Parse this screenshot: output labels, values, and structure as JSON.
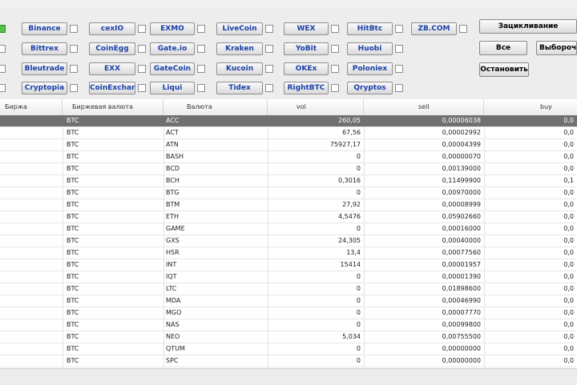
{
  "exchanges": [
    {
      "label": "Binance",
      "checked": false
    },
    {
      "label": "cexIO",
      "checked": false
    },
    {
      "label": "EXMO",
      "checked": false
    },
    {
      "label": "LiveCoin",
      "checked": false
    },
    {
      "label": "WEX",
      "checked": false
    },
    {
      "label": "HitBtc",
      "checked": false
    },
    {
      "label": "ZB.COM",
      "checked": false
    },
    {
      "label": "Bittrex",
      "checked": false
    },
    {
      "label": "CoinEgg",
      "checked": false
    },
    {
      "label": "Gate.io",
      "checked": false
    },
    {
      "label": "Kraken",
      "checked": false
    },
    {
      "label": "YoBit",
      "checked": false
    },
    {
      "label": "Huobi",
      "checked": false
    },
    {
      "label": "Bleutrade",
      "checked": false
    },
    {
      "label": "EXX",
      "checked": false
    },
    {
      "label": "GateCoin",
      "checked": false
    },
    {
      "label": "Kucoin",
      "checked": false
    },
    {
      "label": "OKEx",
      "checked": false
    },
    {
      "label": "Poloniex",
      "checked": false
    },
    {
      "label": "Cryptopia",
      "checked": false
    },
    {
      "label": "CoinExchange",
      "checked": false
    },
    {
      "label": "Liqui",
      "checked": false
    },
    {
      "label": "Tidex",
      "checked": false
    },
    {
      "label": "RightBTC",
      "checked": false
    },
    {
      "label": "Qryptos",
      "checked": false
    }
  ],
  "left_checkboxes_checked": [
    true,
    false,
    false,
    false
  ],
  "actions": {
    "loop": "Зацикливание",
    "all": "Все",
    "selective": "Выборочн",
    "stop": "Остановить"
  },
  "table": {
    "headers": [
      "Биржа",
      "Биржевая валюта",
      "Валюта",
      "vol",
      "sell",
      "buy"
    ],
    "rows": [
      {
        "exchange": "",
        "base": "BTC",
        "currency": "ACC",
        "vol": "260,05",
        "sell": "0,00006038",
        "buy": "0,0"
      },
      {
        "exchange": "",
        "base": "BTC",
        "currency": "ACT",
        "vol": "67,56",
        "sell": "0,00002992",
        "buy": "0,0"
      },
      {
        "exchange": "",
        "base": "BTC",
        "currency": "ATN",
        "vol": "75927,17",
        "sell": "0,00004399",
        "buy": "0,0"
      },
      {
        "exchange": "",
        "base": "BTC",
        "currency": "BASH",
        "vol": "0",
        "sell": "0,00000070",
        "buy": "0,0"
      },
      {
        "exchange": "",
        "base": "BTC",
        "currency": "BCD",
        "vol": "0",
        "sell": "0,00139000",
        "buy": "0,0"
      },
      {
        "exchange": "",
        "base": "BTC",
        "currency": "BCH",
        "vol": "0,3016",
        "sell": "0,11499900",
        "buy": "0,1"
      },
      {
        "exchange": "",
        "base": "BTC",
        "currency": "BTG",
        "vol": "0",
        "sell": "0,00970000",
        "buy": "0,0"
      },
      {
        "exchange": "",
        "base": "BTC",
        "currency": "BTM",
        "vol": "27,92",
        "sell": "0,00008999",
        "buy": "0,0"
      },
      {
        "exchange": "",
        "base": "BTC",
        "currency": "ETH",
        "vol": "4,5476",
        "sell": "0,05902660",
        "buy": "0,0"
      },
      {
        "exchange": "",
        "base": "BTC",
        "currency": "GAME",
        "vol": "0",
        "sell": "0,00016000",
        "buy": "0,0"
      },
      {
        "exchange": "",
        "base": "BTC",
        "currency": "GXS",
        "vol": "24,305",
        "sell": "0,00040000",
        "buy": "0,0"
      },
      {
        "exchange": "",
        "base": "BTC",
        "currency": "HSR",
        "vol": "13,4",
        "sell": "0,00077560",
        "buy": "0,0"
      },
      {
        "exchange": "",
        "base": "BTC",
        "currency": "INT",
        "vol": "15414",
        "sell": "0,00001957",
        "buy": "0,0"
      },
      {
        "exchange": "",
        "base": "BTC",
        "currency": "IQT",
        "vol": "0",
        "sell": "0,00001390",
        "buy": "0,0"
      },
      {
        "exchange": "",
        "base": "BTC",
        "currency": "LTC",
        "vol": "0",
        "sell": "0,01898600",
        "buy": "0,0"
      },
      {
        "exchange": "",
        "base": "BTC",
        "currency": "MDA",
        "vol": "0",
        "sell": "0,00046990",
        "buy": "0,0"
      },
      {
        "exchange": "",
        "base": "BTC",
        "currency": "MGO",
        "vol": "0",
        "sell": "0,00007770",
        "buy": "0,0"
      },
      {
        "exchange": "",
        "base": "BTC",
        "currency": "NAS",
        "vol": "0",
        "sell": "0,00099800",
        "buy": "0,0"
      },
      {
        "exchange": "",
        "base": "BTC",
        "currency": "NEO",
        "vol": "5,034",
        "sell": "0,00755500",
        "buy": "0,0"
      },
      {
        "exchange": "",
        "base": "BTC",
        "currency": "QTUM",
        "vol": "0",
        "sell": "0,00000000",
        "buy": "0,0"
      },
      {
        "exchange": "",
        "base": "BTC",
        "currency": "SPC",
        "vol": "0",
        "sell": "0,00000000",
        "buy": "0,0"
      }
    ]
  }
}
